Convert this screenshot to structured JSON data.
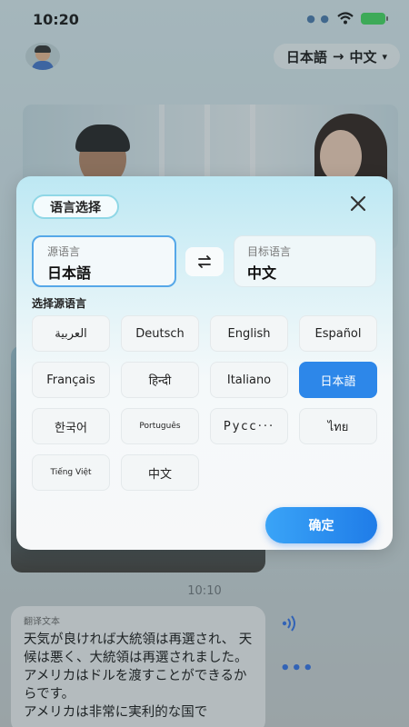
{
  "status_bar": {
    "time": "10:20"
  },
  "header": {
    "source_lang": "日本語",
    "arrow": "→",
    "target_lang": "中文",
    "caret": "▾"
  },
  "chat": {
    "timestamp": "10:10",
    "bubble_label": "翻译文本",
    "bubble_text": "天気が良ければ大統領は再選され、 天候は悪く、大統領は再選されました。\nアメリカはドルを渡すことができるからです。\nアメリカは非常に実利的な国で"
  },
  "modal": {
    "title": "语言选择",
    "source_label": "源语言",
    "source_value": "日本語",
    "target_label": "目标语言",
    "target_value": "中文",
    "section_label": "选择源语言",
    "languages": [
      "العربية",
      "Deutsch",
      "English",
      "Español",
      "Français",
      "हिन्दी",
      "Italiano",
      "日本語",
      "한국어",
      "Português",
      "Русс···",
      "ไทย",
      "Tiếng Việt",
      "中文"
    ],
    "selected_language": "日本語",
    "confirm_label": "确定"
  },
  "colors": {
    "accent": "#2d87e9",
    "selected_border": "#56a8e8"
  }
}
